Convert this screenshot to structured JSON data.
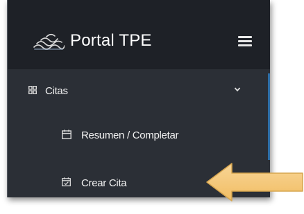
{
  "header": {
    "brand": "Portal TPE",
    "logo_icon": "waves-logo-icon",
    "menu_icon": "hamburger-icon"
  },
  "sidebar": {
    "items": [
      {
        "label": "Citas",
        "icon": "grid-icon",
        "expanded": true
      },
      {
        "label": "Resumen / Completar",
        "icon": "calendar-icon"
      },
      {
        "label": "Crear Cita",
        "icon": "calendar-check-icon"
      }
    ]
  },
  "colors": {
    "header_bg": "#1e2127",
    "sidebar_bg": "#2b2f36",
    "accent": "#2f6fa8",
    "arrow_fill": "#f6c978",
    "arrow_stroke": "#d4a452"
  }
}
